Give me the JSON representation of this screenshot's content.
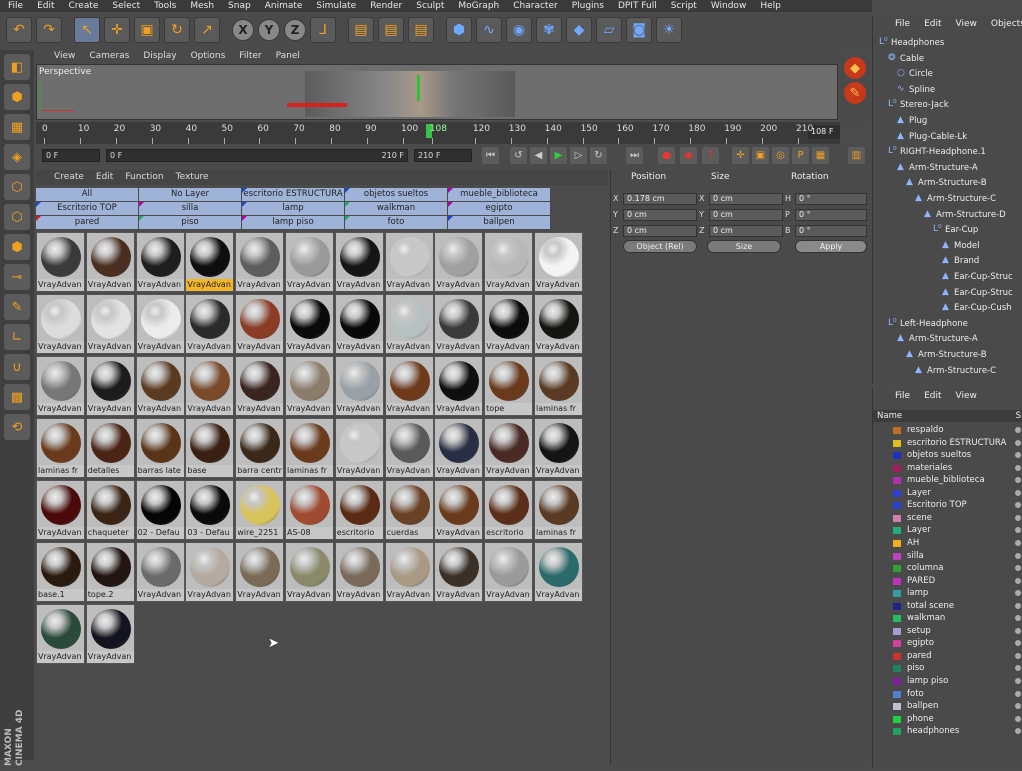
{
  "menubar": [
    "File",
    "Edit",
    "Create",
    "Select",
    "Tools",
    "Mesh",
    "Snap",
    "Animate",
    "Simulate",
    "Render",
    "Sculpt",
    "MoGraph",
    "Character",
    "Plugins",
    "DPIT Full",
    "Script",
    "Window",
    "Help"
  ],
  "toolbar": {
    "icons": [
      "undo-icon",
      "redo-icon",
      "live-select-icon",
      "move-icon",
      "scale-icon",
      "rotate-icon",
      "last-tool-icon",
      "x-axis-icon",
      "y-axis-icon",
      "z-axis-icon",
      "coordinate-system-icon",
      "render-view-icon",
      "render-picture-viewer-icon",
      "render-settings-icon",
      "cube-icon",
      "spline-pen-icon",
      "nurbs-icon",
      "array-icon",
      "deformer-icon",
      "floor-icon",
      "camera-icon",
      "light-icon"
    ],
    "axis_labels": [
      "X",
      "Y",
      "Z"
    ]
  },
  "viewport": {
    "menu": [
      "View",
      "Cameras",
      "Display",
      "Options",
      "Filter",
      "Panel"
    ],
    "label": "Perspective"
  },
  "timeline": {
    "ticks": [
      "0",
      "10",
      "20",
      "30",
      "40",
      "50",
      "60",
      "70",
      "80",
      "90",
      "100",
      "108",
      "120",
      "130",
      "140",
      "150",
      "160",
      "170",
      "180",
      "190",
      "200",
      "210"
    ],
    "end_display": "108 F",
    "current_frame": 108,
    "max_frame": 210
  },
  "transport": {
    "start": "0 F",
    "min": "0 F",
    "max": "210 F",
    "end": "210 F"
  },
  "material_manager": {
    "menu": [
      "Create",
      "Edit",
      "Function",
      "Texture"
    ],
    "layers": [
      "All",
      "No Layer",
      "escritorio ESTRUCTURA",
      "objetos sueltos",
      "mueble_biblioteca",
      "Escritorio TOP",
      "silla",
      "lamp",
      "walkman",
      "egipto",
      "pared",
      "piso",
      "lamp piso",
      "foto",
      "ballpen"
    ],
    "layer_colors": [
      "",
      "",
      "#2244cc",
      "#2244cc",
      "#b000b0",
      "#2244cc",
      "#b000b0",
      "#2244cc",
      "#22aa66",
      "#b000b0",
      "#c02020",
      "#22aa66",
      "#b000b0",
      "#22aa66",
      "#2244cc"
    ],
    "materials": [
      {
        "label": "VrayAdvan",
        "color": "#3a3a3a",
        "sel": false
      },
      {
        "label": "VrayAdvan",
        "color": "#4a2e20",
        "sel": false
      },
      {
        "label": "VrayAdvan",
        "color": "#1e1e1e",
        "sel": false
      },
      {
        "label": "VrayAdvan",
        "color": "#0e0e0e",
        "sel": true
      },
      {
        "label": "VrayAdvan",
        "color": "#5e5e5e",
        "sel": false
      },
      {
        "label": "VrayAdvan",
        "color": "#9a9a9a",
        "sel": false
      },
      {
        "label": "VrayAdvan",
        "color": "#151515",
        "sel": false
      },
      {
        "label": "VrayAdvan",
        "color": "#c8c8c8",
        "sel": false
      },
      {
        "label": "VrayAdvan",
        "color": "#a0a0a0",
        "sel": false
      },
      {
        "label": "VrayAdvan",
        "color": "#b8b8b8",
        "sel": false
      },
      {
        "label": "VrayAdvan",
        "color": "#f4f4f4",
        "sel": false
      },
      {
        "label": "VrayAdvan",
        "color": "#dcdcdc",
        "sel": false
      },
      {
        "label": "VrayAdvan",
        "color": "#e2e2e2",
        "sel": false
      },
      {
        "label": "VrayAdvan",
        "color": "#ececec",
        "sel": false
      },
      {
        "label": "VrayAdvan",
        "color": "#2a2a2a",
        "sel": false
      },
      {
        "label": "VrayAdvan",
        "color": "#8a3c24",
        "sel": false
      },
      {
        "label": "VrayAdvan",
        "color": "#0a0a0a",
        "sel": false
      },
      {
        "label": "VrayAdvan",
        "color": "#080808",
        "sel": false
      },
      {
        "label": "VrayAdvan",
        "color": "#b6c0c0",
        "sel": false
      },
      {
        "label": "VrayAdvan",
        "color": "#3a3a3a",
        "sel": false
      },
      {
        "label": "VrayAdvan",
        "color": "#0c0c0c",
        "sel": false
      },
      {
        "label": "VrayAdvan",
        "color": "#151510",
        "sel": false
      },
      {
        "label": "VrayAdvan",
        "color": "#777777",
        "sel": false
      },
      {
        "label": "VrayAdvan",
        "color": "#1c1c1c",
        "sel": false
      },
      {
        "label": "VrayAdvan",
        "color": "#5a3a20",
        "sel": false
      },
      {
        "label": "VrayAdvan",
        "color": "#7a4a2a",
        "sel": false
      },
      {
        "label": "VrayAdvan",
        "color": "#3a2420",
        "sel": false
      },
      {
        "label": "VrayAdvan",
        "color": "#8c7c6a",
        "sel": false
      },
      {
        "label": "VrayAdvan",
        "color": "#9aa0a8",
        "sel": false
      },
      {
        "label": "VrayAdvan",
        "color": "#6e3a1c",
        "sel": false
      },
      {
        "label": "VrayAdvan",
        "color": "#0e0e0e",
        "sel": false
      },
      {
        "label": "tope",
        "color": "#6a3a1c",
        "sel": false
      },
      {
        "label": "laminas fr",
        "color": "#5a3a22",
        "sel": false
      },
      {
        "label": "laminas fr",
        "color": "#6a3a1c",
        "sel": false
      },
      {
        "label": "detalles",
        "color": "#4a2414",
        "sel": false
      },
      {
        "label": "barras late",
        "color": "#5a3418",
        "sel": false
      },
      {
        "label": "base",
        "color": "#3a2012",
        "sel": false
      },
      {
        "label": "barra centr",
        "color": "#3a2818",
        "sel": false
      },
      {
        "label": "laminas fr",
        "color": "#6a3a1c",
        "sel": false
      },
      {
        "label": "VrayAdvan",
        "color": "#c8c8c8",
        "sel": false
      },
      {
        "label": "VrayAdvan",
        "color": "#5a5a5a",
        "sel": false
      },
      {
        "label": "VrayAdvan",
        "color": "#2a2e44",
        "sel": false
      },
      {
        "label": "VrayAdvan",
        "color": "#4a2a24",
        "sel": false
      },
      {
        "label": "VrayAdvan",
        "color": "#141414",
        "sel": false
      },
      {
        "label": "VrayAdvan",
        "color": "#4a0a0a",
        "sel": false
      },
      {
        "label": "chaqueter",
        "color": "#3a2414",
        "sel": false
      },
      {
        "label": "02 - Defau",
        "color": "#050505",
        "sel": false
      },
      {
        "label": "03 - Defau",
        "color": "#0a0a0a",
        "sel": false
      },
      {
        "label": "wire_2251",
        "color": "#d8c25a",
        "sel": false
      },
      {
        "label": "AS-08",
        "color": "#a04a32",
        "sel": false
      },
      {
        "label": "escritorio",
        "color": "#5a2a14",
        "sel": false
      },
      {
        "label": "cuerdas",
        "color": "#6a4226",
        "sel": false
      },
      {
        "label": "VrayAdvan",
        "color": "#6a3a1c",
        "sel": false
      },
      {
        "label": "escritorio",
        "color": "#5a2e18",
        "sel": false
      },
      {
        "label": "laminas fr",
        "color": "#5a3a22",
        "sel": false
      },
      {
        "label": "base.1",
        "color": "#2a1a10",
        "sel": false
      },
      {
        "label": "tope.2",
        "color": "#221410",
        "sel": false
      },
      {
        "label": "VrayAdvan",
        "color": "#6a6a6a",
        "sel": false
      },
      {
        "label": "VrayAdvan",
        "color": "#b4aaa0",
        "sel": false
      },
      {
        "label": "VrayAdvan",
        "color": "#7a6a56",
        "sel": false
      },
      {
        "label": "VrayAdvan",
        "color": "#8a8a6a",
        "sel": false
      },
      {
        "label": "VrayAdvan",
        "color": "#7a6a5a",
        "sel": false
      },
      {
        "label": "VrayAdvan",
        "color": "#a89a84",
        "sel": false
      },
      {
        "label": "VrayAdvan",
        "color": "#3a3028",
        "sel": false
      },
      {
        "label": "VrayAdvan",
        "color": "#9a9a9a",
        "sel": false
      },
      {
        "label": "VrayAdvan",
        "color": "#2a6a6a",
        "sel": false
      },
      {
        "label": "VrayAdvan",
        "color": "#2a4a3a",
        "sel": false
      },
      {
        "label": "VrayAdvan",
        "color": "#141420",
        "sel": false
      }
    ]
  },
  "attributes": {
    "headers": [
      "Position",
      "Size",
      "Rotation"
    ],
    "rows": [
      {
        "axis": "X",
        "pos": "0.178 cm",
        "size_axis": "X",
        "size": "0 cm",
        "rot_axis": "H",
        "rot": "0 °"
      },
      {
        "axis": "Y",
        "pos": "0 cm",
        "size_axis": "Y",
        "size": "0 cm",
        "rot_axis": "P",
        "rot": "0 °"
      },
      {
        "axis": "Z",
        "pos": "0 cm",
        "size_axis": "Z",
        "size": "0 cm",
        "rot_axis": "B",
        "rot": "0 °"
      }
    ],
    "mode": "Object (Rel)",
    "size_mode": "Size",
    "apply": "Apply"
  },
  "objects": {
    "menu": [
      "File",
      "Edit",
      "View",
      "Objects"
    ],
    "items": [
      {
        "name": "Headphones",
        "level": 0,
        "icon": "null-icon"
      },
      {
        "name": "Cable",
        "level": 1,
        "icon": "sweep-icon"
      },
      {
        "name": "Circle",
        "level": 2,
        "icon": "circle-icon"
      },
      {
        "name": "Spline",
        "level": 2,
        "icon": "spline-icon"
      },
      {
        "name": "Stereo-Jack",
        "level": 1,
        "icon": "null-icon"
      },
      {
        "name": "Plug",
        "level": 2,
        "icon": "polygon-icon"
      },
      {
        "name": "Plug-Cable-Lk",
        "level": 2,
        "icon": "polygon-icon"
      },
      {
        "name": "RIGHT-Headphone.1",
        "level": 1,
        "icon": "null-icon"
      },
      {
        "name": "Arm-Structure-A",
        "level": 2,
        "icon": "polygon-icon"
      },
      {
        "name": "Arm-Structure-B",
        "level": 3,
        "icon": "polygon-icon"
      },
      {
        "name": "Arm-Structure-C",
        "level": 4,
        "icon": "polygon-icon"
      },
      {
        "name": "Arm-Structure-D",
        "level": 5,
        "icon": "polygon-icon"
      },
      {
        "name": "Ear-Cup",
        "level": 6,
        "icon": "null-icon"
      },
      {
        "name": "Model",
        "level": 7,
        "icon": "polygon-icon"
      },
      {
        "name": "Brand",
        "level": 7,
        "icon": "polygon-icon"
      },
      {
        "name": "Ear-Cup-Struc",
        "level": 7,
        "icon": "polygon-icon"
      },
      {
        "name": "Ear-Cup-Struc",
        "level": 7,
        "icon": "polygon-icon"
      },
      {
        "name": "Ear-Cup-Cush",
        "level": 7,
        "icon": "polygon-icon"
      },
      {
        "name": "Left-Headphone",
        "level": 1,
        "icon": "null-icon"
      },
      {
        "name": "Arm-Structure-A",
        "level": 2,
        "icon": "polygon-icon"
      },
      {
        "name": "Arm-Structure-B",
        "level": 3,
        "icon": "polygon-icon"
      },
      {
        "name": "Arm-Structure-C",
        "level": 4,
        "icon": "polygon-icon"
      }
    ]
  },
  "layers": {
    "menu": [
      "File",
      "Edit",
      "View"
    ],
    "header": "Name",
    "header_s": "S",
    "items": [
      {
        "name": "respaldo",
        "color": "#c07020"
      },
      {
        "name": "escritorio ESTRUCTURA",
        "color": "#e0c020"
      },
      {
        "name": "objetos sueltos",
        "color": "#2030c0"
      },
      {
        "name": "materiales",
        "color": "#a02060"
      },
      {
        "name": "mueble_biblioteca",
        "color": "#b030b0"
      },
      {
        "name": "Layer",
        "color": "#3040d0"
      },
      {
        "name": "Escritorio TOP",
        "color": "#2a40d0"
      },
      {
        "name": "scene",
        "color": "#d080b0"
      },
      {
        "name": "Layer",
        "color": "#20b080"
      },
      {
        "name": "AH",
        "color": "#f0b020"
      },
      {
        "name": "silla",
        "color": "#c040c0"
      },
      {
        "name": "columna",
        "color": "#30a030"
      },
      {
        "name": "PARED",
        "color": "#c030c0"
      },
      {
        "name": "lamp",
        "color": "#30a0a0"
      },
      {
        "name": "total scene",
        "color": "#202090"
      },
      {
        "name": "walkman",
        "color": "#20c060"
      },
      {
        "name": "setup",
        "color": "#a0a0d0"
      },
      {
        "name": "egipto",
        "color": "#d040a0"
      },
      {
        "name": "pared",
        "color": "#d03030"
      },
      {
        "name": "piso",
        "color": "#208060"
      },
      {
        "name": "lamp piso",
        "color": "#8020a0"
      },
      {
        "name": "foto",
        "color": "#5080d0"
      },
      {
        "name": "ballpen",
        "color": "#c0c0d0"
      },
      {
        "name": "phone",
        "color": "#20d040"
      },
      {
        "name": "headphones",
        "color": "#20a060"
      }
    ]
  },
  "branding": "MAXON CINEMA 4D"
}
